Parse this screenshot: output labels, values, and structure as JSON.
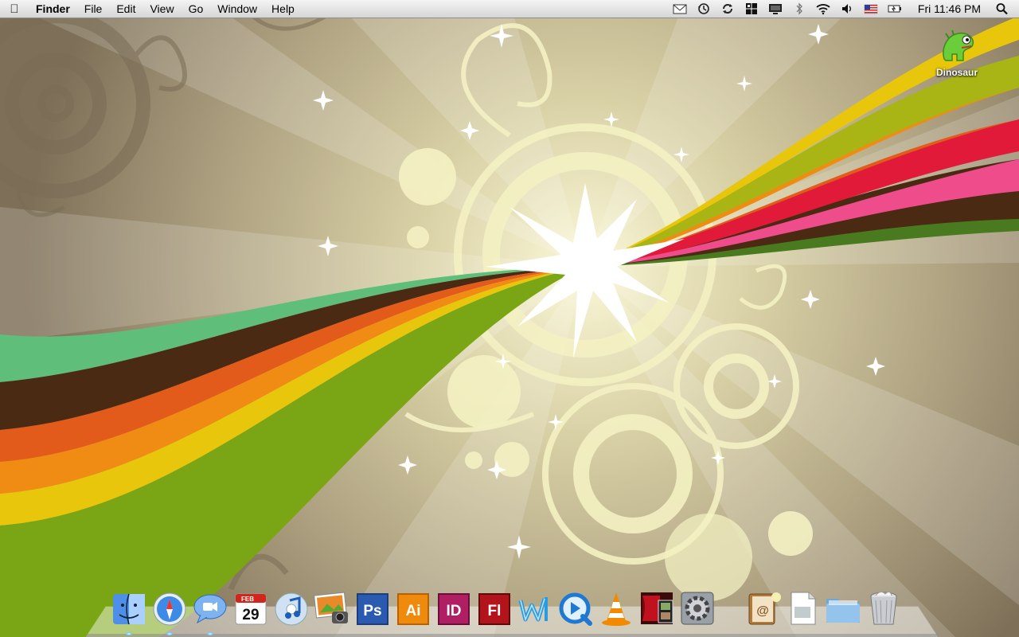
{
  "menubar": {
    "app_name": "Finder",
    "items": [
      "File",
      "Edit",
      "View",
      "Go",
      "Window",
      "Help"
    ],
    "clock": "Fri 11:46 PM",
    "status_icons": [
      "mail-icon",
      "time-machine-icon",
      "sync-icon",
      "spaces-icon",
      "display-icon",
      "bluetooth-icon",
      "wifi-icon",
      "volume-icon",
      "us-flag-icon",
      "battery-icon"
    ]
  },
  "desktop_icon": {
    "label": "Dinosaur"
  },
  "dock": {
    "calendar": {
      "month": "FEB",
      "day": "29"
    },
    "tiles": {
      "ps": "Ps",
      "ai": "Ai",
      "id": "ID",
      "fl": "Fl"
    },
    "items": [
      "Finder",
      "Safari",
      "iChat",
      "iCal",
      "iTunes",
      "iPhoto",
      "Photoshop",
      "Illustrator",
      "InDesign",
      "Flash",
      "Dreamweaver",
      "QuickTime",
      "VLC",
      "DVD Player",
      "System Preferences",
      "Address Book",
      "Preview",
      "Documents",
      "Trash"
    ]
  },
  "colors": {
    "bg_tan": "#b9ad8f",
    "cream": "#f3f0be",
    "rainbow": [
      "#5fbf7a",
      "#4a2a12",
      "#e35b1a",
      "#f08c14",
      "#e8c60c",
      "#7aa514"
    ]
  }
}
